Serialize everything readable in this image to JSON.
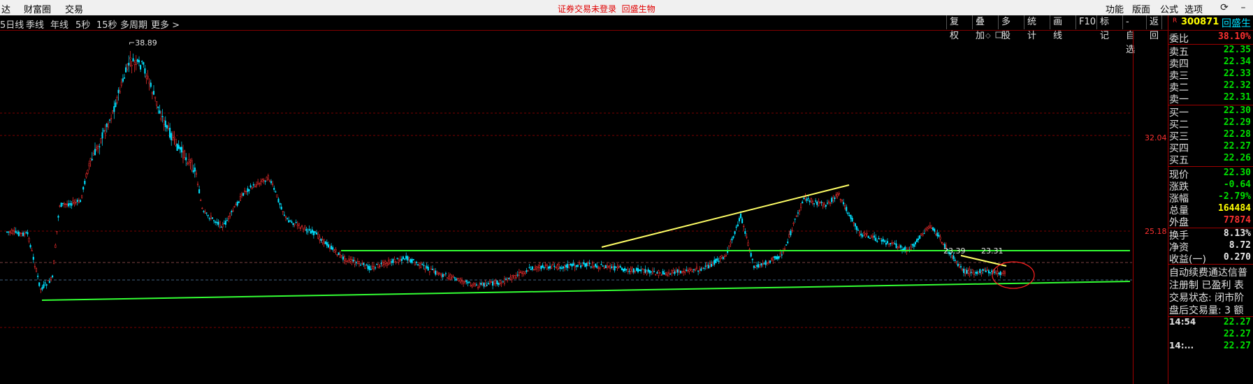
{
  "top_menu": {
    "items": [
      "达",
      "财富圈",
      "交易"
    ],
    "notice": "证券交易未登录",
    "stock_name": "回盛生物",
    "right_items": [
      "功能",
      "版面",
      "公式",
      "选项"
    ]
  },
  "periods": [
    "5日线",
    "季线",
    "年线",
    "5秒",
    "15秒",
    "多周期",
    "更多 >"
  ],
  "toolbar": [
    "复权",
    "叠加",
    "多股",
    "统计",
    "画线",
    "F10",
    "标记",
    "-自选",
    "返回"
  ],
  "code": {
    "badge": "R",
    "code": "300871",
    "name": "回盛生"
  },
  "chart": {
    "high_label": "38.89",
    "y_labels": [
      "32.04",
      "25.18"
    ],
    "ann1": "23.39",
    "ann2": "23.31"
  },
  "panel": {
    "weibi": {
      "label": "委比",
      "value": "38.10%"
    },
    "sells": [
      {
        "label": "卖五",
        "value": "22.35"
      },
      {
        "label": "卖四",
        "value": "22.34"
      },
      {
        "label": "卖三",
        "value": "22.33"
      },
      {
        "label": "卖二",
        "value": "22.32"
      },
      {
        "label": "卖一",
        "value": "22.31"
      }
    ],
    "buys": [
      {
        "label": "买一",
        "value": "22.30"
      },
      {
        "label": "买二",
        "value": "22.29"
      },
      {
        "label": "买三",
        "value": "22.28"
      },
      {
        "label": "买四",
        "value": "22.27"
      },
      {
        "label": "买五",
        "value": "22.26"
      }
    ],
    "quotes": [
      {
        "label": "现价",
        "value": "22.30"
      },
      {
        "label": "涨跌",
        "value": "-0.64"
      },
      {
        "label": "涨幅",
        "value": "-2.79%"
      },
      {
        "label": "总量",
        "value": "164484"
      },
      {
        "label": "外盘",
        "value": "77874"
      }
    ],
    "stats": [
      {
        "label": "换手",
        "value": "8.13%"
      },
      {
        "label": "净资",
        "value": "8.72"
      },
      {
        "label": "收益(一)",
        "value": "0.270"
      }
    ],
    "info": [
      "自动续费通达信普",
      "注册制 已盈利 表",
      "交易状态: 闭市阶",
      "盘后交易量: 3  额"
    ],
    "ticks": [
      {
        "time": "14:54",
        "value": "22.27"
      },
      {
        "time": "",
        "value": "22.27"
      },
      {
        "time": "14:...",
        "value": "22.27"
      }
    ]
  },
  "colors": {
    "up": "#ff3030",
    "down": "#00e0ff",
    "support": "#33ff33",
    "trend": "#ffff66"
  }
}
